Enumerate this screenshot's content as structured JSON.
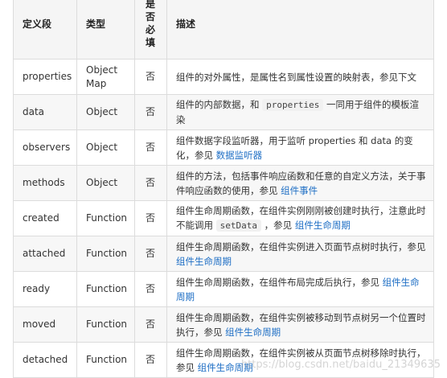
{
  "headers": {
    "name": "定义段",
    "type": "类型",
    "required": "是否必填",
    "desc": "描述"
  },
  "rows": [
    {
      "name": "properties",
      "type": "Object Map",
      "required": "否",
      "desc": {
        "before": "组件的对外属性，是属性名到属性设置的映射表，参见下文"
      }
    },
    {
      "name": "data",
      "type": "Object",
      "required": "否",
      "desc": {
        "before": "组件的内部数据，和",
        "code": "properties",
        "after": "一同用于组件的模板渲染"
      }
    },
    {
      "name": "observers",
      "type": "Object",
      "required": "否",
      "desc": {
        "before": "组件数据字段监听器，用于监听 properties 和 data 的变化，参见",
        "link": "数据监听器"
      }
    },
    {
      "name": "methods",
      "type": "Object",
      "required": "否",
      "desc": {
        "before": "组件的方法，包括事件响应函数和任意的自定义方法，关于事件响应函数的使用，参见",
        "link": "组件事件"
      }
    },
    {
      "name": "created",
      "type": "Function",
      "required": "否",
      "desc": {
        "before": "组件生命周期函数，在组件实例刚刚被创建时执行，注意此时不能调用",
        "code": "setData",
        "after": "，参见",
        "link": "组件生命周期"
      }
    },
    {
      "name": "attached",
      "type": "Function",
      "required": "否",
      "desc": {
        "before": "组件生命周期函数，在组件实例进入页面节点树时执行，参见",
        "link": "组件生命周期"
      }
    },
    {
      "name": "ready",
      "type": "Function",
      "required": "否",
      "desc": {
        "before": "组件生命周期函数，在组件布局完成后执行，参见",
        "link": "组件生命周期"
      }
    },
    {
      "name": "moved",
      "type": "Function",
      "required": "否",
      "desc": {
        "before": "组件生命周期函数，在组件实例被移动到节点树另一个位置时执行，参见",
        "link": "组件生命周期"
      }
    },
    {
      "name": "detached",
      "type": "Function",
      "required": "否",
      "desc": {
        "before": "组件生命周期函数，在组件实例被从页面节点树移除时执行，参见",
        "link": "组件生命周期"
      }
    }
  ],
  "watermark": "https://blog.csdn.net/baidu_21349635",
  "colors": {
    "link": "#1f6fc5",
    "header_bg": "#f5f5f5",
    "stripe_bg": "#f7f7f7",
    "border": "#dcdcdc"
  }
}
